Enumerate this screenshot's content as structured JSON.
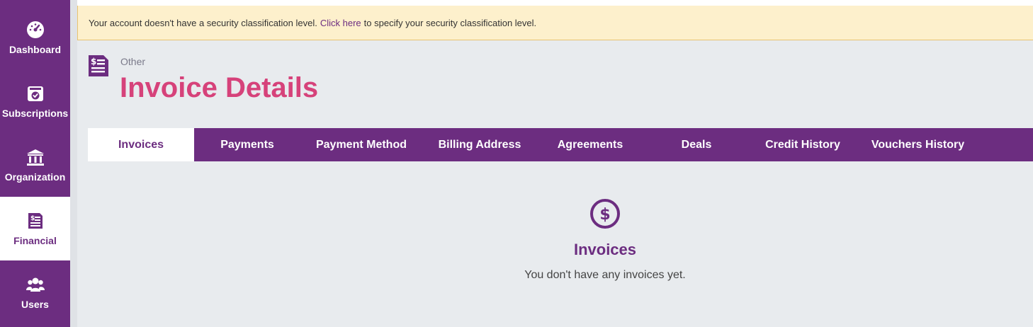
{
  "sidebar": {
    "items": [
      {
        "label": "Dashboard",
        "icon": "dashboard-gauge-icon"
      },
      {
        "label": "Subscriptions",
        "icon": "subscriptions-check-icon"
      },
      {
        "label": "Organization",
        "icon": "organization-building-icon"
      },
      {
        "label": "Financial",
        "icon": "financial-invoice-icon",
        "active": true
      },
      {
        "label": "Users",
        "icon": "users-group-icon"
      }
    ]
  },
  "banner": {
    "text_before": "Your account doesn't have a security classification level.",
    "link_text": "Click here",
    "text_after": "to specify your security classification level."
  },
  "header": {
    "breadcrumb": "Other",
    "title": "Invoice Details",
    "icon": "invoice-icon"
  },
  "tabs": [
    {
      "label": "Invoices",
      "active": true
    },
    {
      "label": "Payments"
    },
    {
      "label": "Payment Method"
    },
    {
      "label": "Billing Address"
    },
    {
      "label": "Agreements"
    },
    {
      "label": "Deals"
    },
    {
      "label": "Credit History"
    },
    {
      "label": "Vouchers History"
    }
  ],
  "empty_state": {
    "icon": "dollar-circle-icon",
    "title": "Invoices",
    "message": "You don't have any invoices yet."
  },
  "colors": {
    "brand_purple": "#6c2d80",
    "title_pink": "#d6427a",
    "banner_bg": "#fdf0cc",
    "background": "#e8ebee"
  }
}
